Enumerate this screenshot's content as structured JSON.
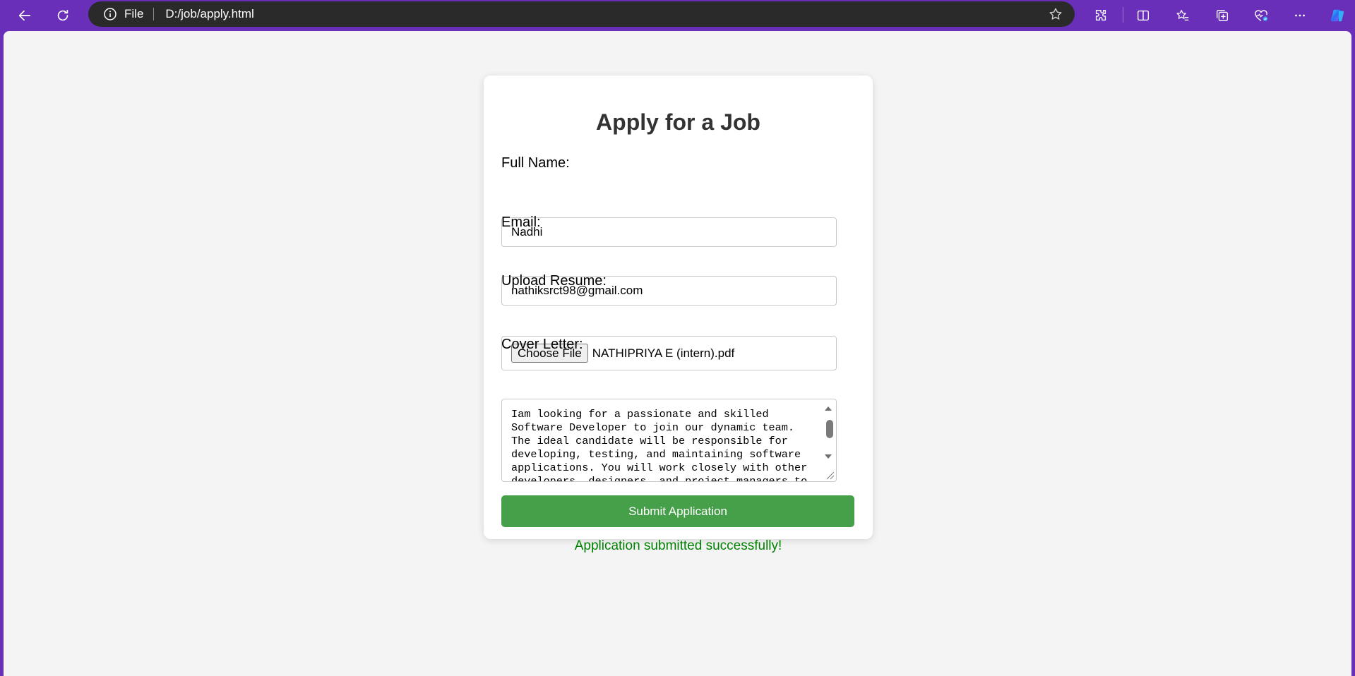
{
  "browser": {
    "address_scheme": "File",
    "address_url": "D:/job/apply.html"
  },
  "form": {
    "title": "Apply for a Job",
    "full_name": {
      "label": "Full Name:",
      "value": "Nadhi"
    },
    "email": {
      "label": "Email:",
      "value": "nathiksrct98@gmail.com"
    },
    "resume": {
      "label": "Upload Resume:",
      "button_label": "Choose File",
      "file_name": "NATHIPRIYA E (intern).pdf"
    },
    "cover_letter": {
      "label": "Cover Letter:",
      "value": "Iam looking for a passionate and skilled Software Developer to join our dynamic team. The ideal candidate will be responsible for developing, testing, and maintaining software applications. You will work closely with other developers, designers, and project managers to"
    },
    "submit_label": "Submit Application",
    "status_message": "Application submitted successfully!"
  },
  "colors": {
    "chrome_bg": "#6a2fb8",
    "submit_bg": "#45a049",
    "success_text": "#008000"
  }
}
